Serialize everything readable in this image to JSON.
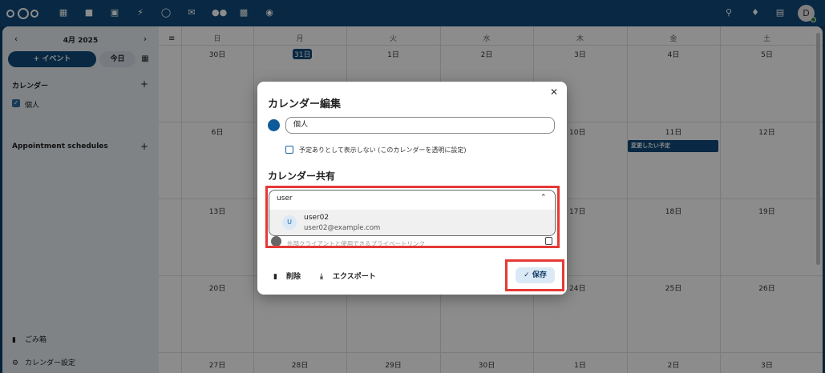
{
  "header": {
    "icons": [
      "nextcloud-logo",
      "dashboard-icon",
      "files-icon",
      "photos-icon",
      "activity-icon",
      "talk-icon",
      "mail-icon",
      "contacts-icon",
      "calendar-icon",
      "deck-icon",
      "search-icon",
      "notifications-icon",
      "contacts-menu-icon"
    ],
    "avatar_letter": "D"
  },
  "sidebar": {
    "month": "4月 2025",
    "new_event": "+ イベント",
    "today": "今日",
    "calendars_heading": "カレンダー",
    "calendar_item": "個人",
    "appointments_heading": "Appointment schedules",
    "trash": "ごみ箱",
    "settings": "カレンダー設定"
  },
  "grid": {
    "weekdays": [
      "日",
      "月",
      "火",
      "水",
      "木",
      "金",
      "土"
    ],
    "weeks": [
      [
        "30日",
        "31日",
        "1日",
        "2日",
        "3日",
        "4日",
        "5日"
      ],
      [
        "6日",
        "",
        "",
        "",
        "10日",
        "11日",
        "12日"
      ],
      [
        "13日",
        "",
        "",
        "",
        "17日",
        "18日",
        "19日"
      ],
      [
        "20日",
        "",
        "",
        "",
        "24日",
        "25日",
        "26日"
      ],
      [
        "27日",
        "28日",
        "29日",
        "30日",
        "1日",
        "2日",
        "3日"
      ]
    ],
    "event": "変更したい予定"
  },
  "modal": {
    "title": "カレンダー編集",
    "calendar_name": "個人",
    "transparent_label": "予定ありとして表示しない (このカレンダーを透明に設定)",
    "share_title": "カレンダー共有",
    "search_value": "user",
    "result": {
      "avatar": "U",
      "name": "user02",
      "email": "user02@example.com"
    },
    "behind_text": "外部クライアントと使用できるプライベートリンク",
    "delete": "削除",
    "export": "エクスポート",
    "save": "保存",
    "accent_color": "#0f5a99",
    "highlight_color": "#e53935"
  }
}
